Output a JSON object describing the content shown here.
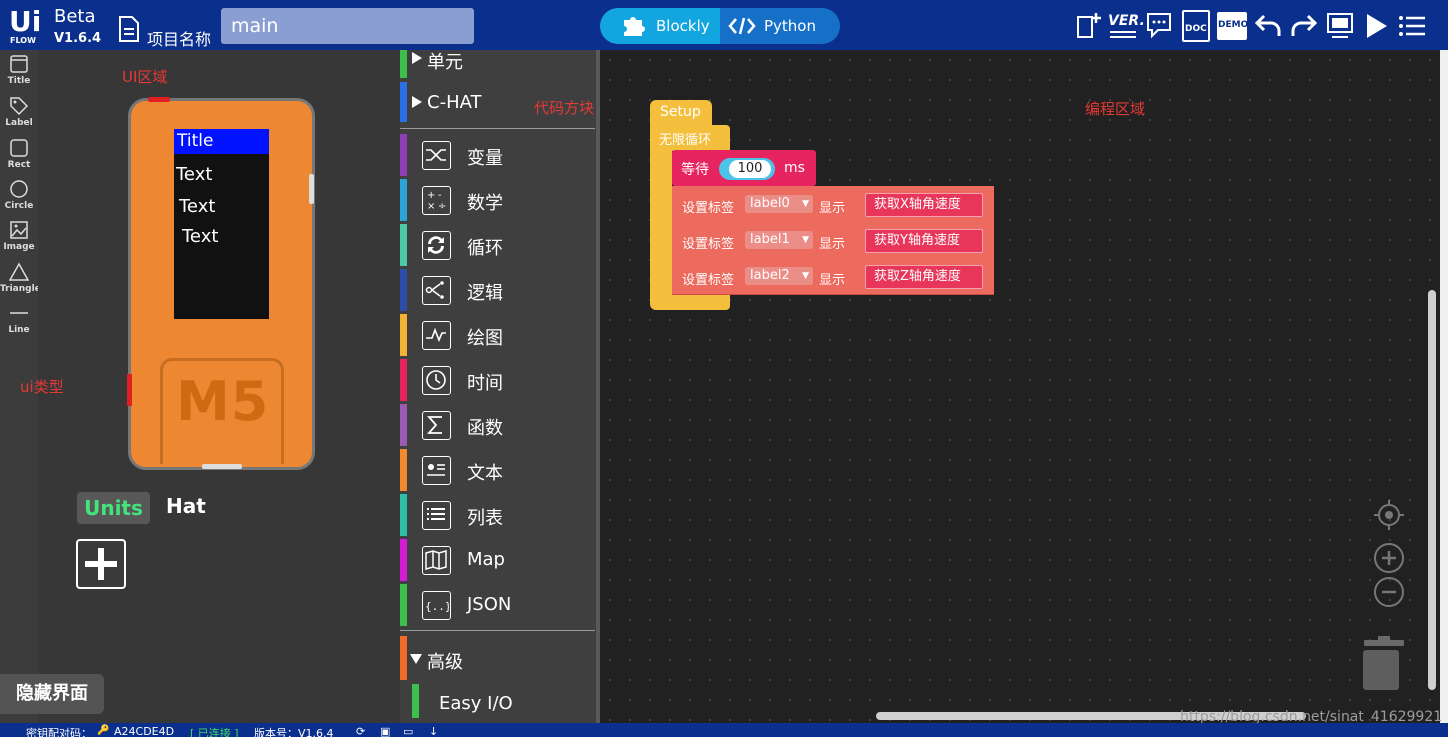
{
  "topbar": {
    "logo_text": "Ui FLOW",
    "beta": "Beta",
    "version": "V1.6.4",
    "project_label": "项目名称",
    "project_value": "main",
    "tab_blockly": "Blockly",
    "tab_python": "Python",
    "icons": [
      "new-file-icon",
      "version-icon",
      "chat-icon",
      "doc-icon",
      "demo-icon",
      "undo-icon",
      "redo-icon",
      "device-icon",
      "run-icon",
      "menu-icon"
    ],
    "ver_label": "VER.",
    "doc_label": "DOC",
    "demo_label": "DEMO"
  },
  "ui_types": [
    {
      "label": "Title",
      "icon": "title-icon"
    },
    {
      "label": "Label",
      "icon": "tag-icon"
    },
    {
      "label": "Rect",
      "icon": "rect-icon"
    },
    {
      "label": "Circle",
      "icon": "circle-icon"
    },
    {
      "label": "Image",
      "icon": "image-icon"
    },
    {
      "label": "Triangle",
      "icon": "triangle-icon"
    },
    {
      "label": "Line",
      "icon": "line-icon"
    }
  ],
  "annotations": {
    "ui_area": "UI区域",
    "ui_type": "ui类型",
    "code_blocks": "代码方块",
    "edit_area": "编程区域"
  },
  "device": {
    "title": "Title",
    "texts": [
      "Text",
      "Text",
      "Text"
    ],
    "logo": "M5",
    "accent": "#ed8732",
    "title_bg": "#0012ff"
  },
  "panel_tabs": {
    "units": "Units",
    "hat": "Hat"
  },
  "hide_ui": "隐藏界面",
  "toolbox": {
    "heads": [
      {
        "label": "单元",
        "color": "#3dbf4e"
      },
      {
        "label": "C-HAT",
        "color": "#2a6fe6"
      }
    ],
    "categories": [
      {
        "label": "变量",
        "color": "#8e3fb5",
        "icon": "shuffle-icon"
      },
      {
        "label": "数学",
        "color": "#2aa3d7",
        "icon": "calculator-icon"
      },
      {
        "label": "循环",
        "color": "#4ec9a5",
        "icon": "loop-icon"
      },
      {
        "label": "逻辑",
        "color": "#2b4fa8",
        "icon": "logic-icon"
      },
      {
        "label": "绘图",
        "color": "#f2b233",
        "icon": "graph-icon"
      },
      {
        "label": "时间",
        "color": "#e6245f",
        "icon": "clock-icon"
      },
      {
        "label": "函数",
        "color": "#9a5bb5",
        "icon": "sigma-icon"
      },
      {
        "label": "文本",
        "color": "#f08a2d",
        "icon": "text-icon"
      },
      {
        "label": "列表",
        "color": "#2ebfa6",
        "icon": "list-icon"
      },
      {
        "label": "Map",
        "color": "#d31cd3",
        "icon": "map-icon"
      },
      {
        "label": "JSON",
        "color": "#3dbf4e",
        "icon": "json-icon"
      }
    ],
    "advanced": {
      "label": "高级",
      "color": "#f26b2a"
    },
    "easy_io": {
      "label": "Easy I/O",
      "color": "#3dbf4e"
    }
  },
  "blocks": {
    "setup": "Setup",
    "loop": "无限循环",
    "wait": {
      "label": "等待",
      "value": "100",
      "unit": "ms"
    },
    "labels": [
      {
        "set": "设置标签",
        "name": "label0",
        "show": "显示",
        "value": "获取X轴角速度"
      },
      {
        "set": "设置标签",
        "name": "label1",
        "show": "显示",
        "value": "获取Y轴角速度"
      },
      {
        "set": "设置标签",
        "name": "label2",
        "show": "显示",
        "value": "获取Z轴角速度"
      }
    ]
  },
  "workspace_controls": [
    "center-icon",
    "zoom-in-icon",
    "zoom-out-icon",
    "trash-icon"
  ],
  "watermark": "https://blog.csdn.net/sinat_41629921",
  "statusbar": {
    "pair_label": "密钥配对码：",
    "key": "A24CDE4D",
    "connected": "[ 已连接 ]",
    "version_label": "版本号：V1.6.4"
  }
}
